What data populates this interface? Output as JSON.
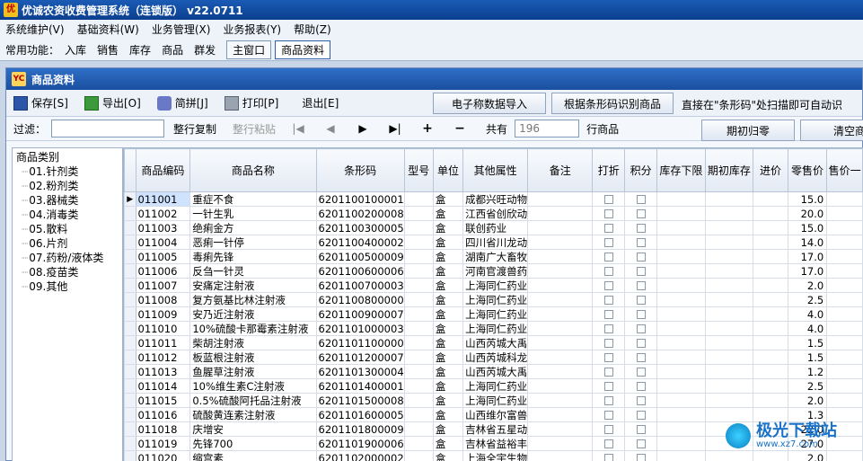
{
  "app": {
    "title": "优诚农资收费管理系统（连锁版）    v22.0711"
  },
  "menu": [
    "系统维护(V)",
    "基础资料(W)",
    "业务管理(X)",
    "业务报表(Y)",
    "帮助(Z)"
  ],
  "quick": {
    "label": "常用功能：",
    "items": [
      "入库",
      "销售",
      "库存",
      "商品",
      "群发"
    ],
    "tabs": [
      "主窗口",
      "商品资料"
    ]
  },
  "window": {
    "title": "商品资料"
  },
  "toolbar": {
    "save": "保存[S]",
    "export": "导出[O]",
    "pinyin": "简拼[J]",
    "print": "打印[P]",
    "exit": "退出[E]",
    "scale_import": "电子称数据导入",
    "barcode_identify": "根据条形码识别商品",
    "hint": "直接在\"条形码\"处扫描即可自动识"
  },
  "filter": {
    "label": "过滤：",
    "copy_row": "整行复制",
    "paste_row": "整行粘贴",
    "nav": [
      "|◀",
      "◀",
      "▶",
      "▶|",
      "+",
      "−"
    ],
    "total_prefix": "共有",
    "total": "196",
    "total_suffix": "行商品",
    "period_reset": "期初归零",
    "clear": "清空商"
  },
  "tree": {
    "root": "商品类别",
    "nodes": [
      "01.针剂类",
      "02.粉剂类",
      "03.器械类",
      "04.消毒类",
      "05.散料",
      "06.片剂",
      "07.药粉/液体类",
      "08.疫苗类",
      "09.其他"
    ]
  },
  "grid": {
    "columns": [
      "商品编码",
      "商品名称",
      "条形码",
      "型号",
      "单位",
      "其他属性",
      "备注",
      "打折",
      "积分",
      "库存下限",
      "期初库存",
      "进价",
      "零售价",
      "售价一"
    ],
    "rows": [
      [
        "011001",
        "重症不食",
        "6201100100001",
        "",
        "盒",
        "成都兴旺动物",
        "",
        "15.0"
      ],
      [
        "011002",
        "一针生乳",
        "6201100200008",
        "",
        "盒",
        "江西省创欣动",
        "",
        "20.0"
      ],
      [
        "011003",
        "绝痢金方",
        "6201100300005",
        "",
        "盒",
        "联创药业",
        "",
        "15.0"
      ],
      [
        "011004",
        "恶痢一针停",
        "6201100400002",
        "",
        "盒",
        "四川省川龙动",
        "",
        "14.0"
      ],
      [
        "011005",
        "毒痢先锋",
        "6201100500009",
        "",
        "盒",
        "湖南广大畜牧",
        "",
        "17.0"
      ],
      [
        "011006",
        "反刍一针灵",
        "6201100600006",
        "",
        "盒",
        "河南官渡兽药",
        "",
        "17.0"
      ],
      [
        "011007",
        "安痛定注射液",
        "6201100700003",
        "",
        "盒",
        "上海同仁药业",
        "",
        "2.0"
      ],
      [
        "011008",
        "复方氨基比林注射液",
        "6201100800000",
        "",
        "盒",
        "上海同仁药业",
        "",
        "2.5"
      ],
      [
        "011009",
        "安乃近注射液",
        "6201100900007",
        "",
        "盒",
        "上海同仁药业",
        "",
        "4.0"
      ],
      [
        "011010",
        "10%硫酸卡那霉素注射液",
        "6201101000003",
        "",
        "盒",
        "上海同仁药业",
        "",
        "4.0"
      ],
      [
        "011011",
        "柴胡注射液",
        "6201101100000",
        "",
        "盒",
        "山西芮城大禹",
        "",
        "1.5"
      ],
      [
        "011012",
        "板蓝根注射液",
        "6201101200007",
        "",
        "盒",
        "山西芮城科龙",
        "",
        "1.5"
      ],
      [
        "011013",
        "鱼腥草注射液",
        "6201101300004",
        "",
        "盒",
        "山西芮城大禹",
        "",
        "1.2"
      ],
      [
        "011014",
        "10%维生素C注射液",
        "6201101400001",
        "",
        "盒",
        "上海同仁药业",
        "",
        "2.5"
      ],
      [
        "011015",
        "0.5%硫酸阿托品注射液",
        "6201101500008",
        "",
        "盒",
        "上海同仁药业",
        "",
        "2.0"
      ],
      [
        "011016",
        "硫酸黄连素注射液",
        "6201101600005",
        "",
        "盒",
        "山西维尔富兽",
        "",
        "1.3"
      ],
      [
        "011018",
        "庆增安",
        "6201101800009",
        "",
        "盒",
        "吉林省五星动",
        "",
        "22.0"
      ],
      [
        "011019",
        "先锋700",
        "6201101900006",
        "",
        "盒",
        "吉林省益裕丰",
        "",
        "27.0"
      ],
      [
        "011020",
        "缩宫素",
        "6201102000002",
        "",
        "盒",
        "上海全宇生物",
        "",
        "2.0"
      ]
    ]
  },
  "watermark": {
    "text": "极光下载站",
    "sub": "www.xz7.com"
  }
}
